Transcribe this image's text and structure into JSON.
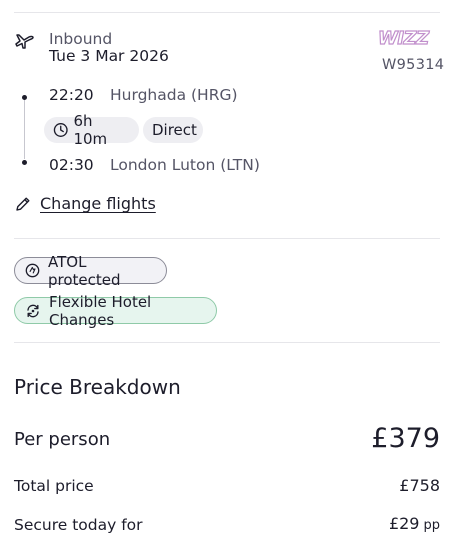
{
  "flight": {
    "direction": "Inbound",
    "date": "Tue 3 Mar 2026",
    "airline_logo": "WIZZ",
    "flight_number": "W95314",
    "departure": {
      "time": "22:20",
      "airport": "Hurghada (HRG)"
    },
    "duration": "6h 10m",
    "stops": "Direct",
    "arrival": {
      "time": "02:30",
      "airport": "London Luton (LTN)"
    },
    "change_label": "Change flights"
  },
  "badges": {
    "atol": "ATOL protected",
    "flexible": "Flexible Hotel Changes"
  },
  "price": {
    "title": "Price Breakdown",
    "per_person_label": "Per person",
    "per_person_value": "£379",
    "total_label": "Total price",
    "total_value": "£758",
    "secure_label": "Secure today for",
    "secure_value": "£29",
    "secure_suffix": "pp"
  },
  "icons": {
    "plane": "plane-landing-icon",
    "clock": "clock-icon",
    "pencil": "pencil-icon",
    "atol": "atol-shield-icon",
    "flexible": "refresh-icon"
  },
  "colors": {
    "text": "#1d1d2b",
    "muted": "#555566",
    "chip_bg": "#eeeef2",
    "flex_bg": "#e6f5ee",
    "flex_border": "#8fcaa8",
    "wizz_logo": "#c18fcc"
  }
}
